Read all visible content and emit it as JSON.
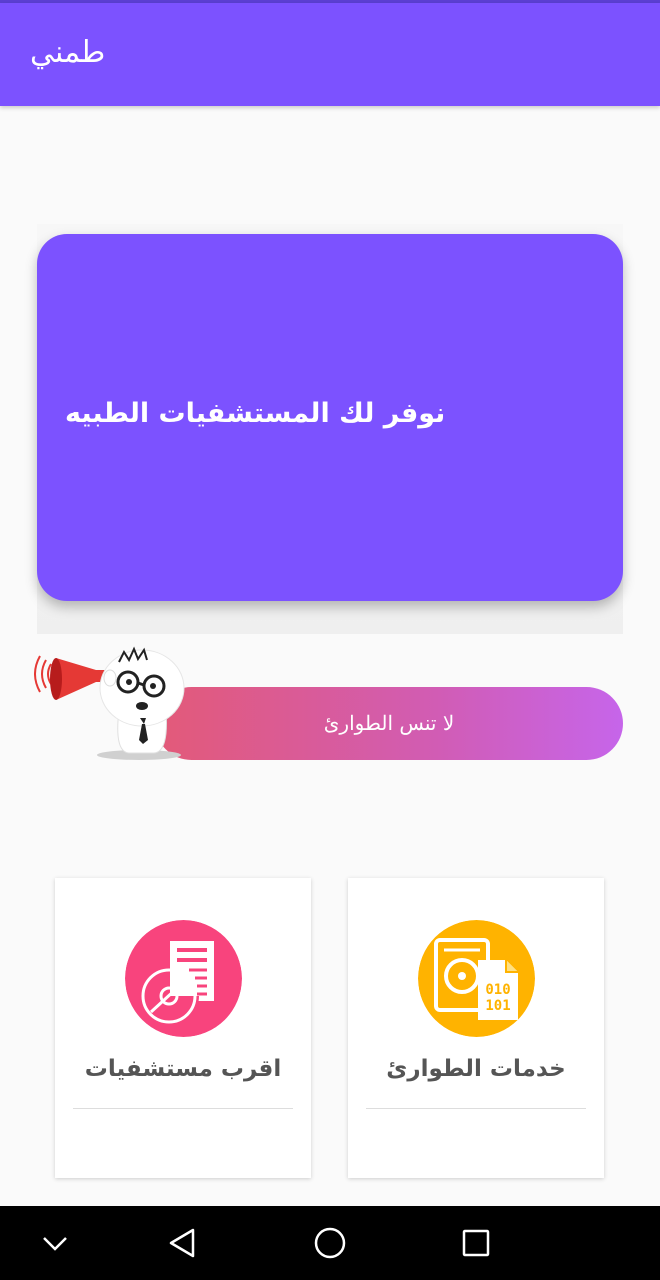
{
  "app_bar": {
    "title": "طمني"
  },
  "banner": {
    "text": "نوفر لك المستشفيات الطبيه"
  },
  "reminder": {
    "text": "لا تنس الطوارئ"
  },
  "cards": [
    {
      "label": "اقرب مستشفيات",
      "icon": "medical-document-disc-icon",
      "color": "#f8447d"
    },
    {
      "label": "خدمات الطوارئ",
      "icon": "hard-drive-binary-file-icon",
      "color": "#ffb300"
    }
  ],
  "colors": {
    "primary": "#7c52ff",
    "reminder_gradient": [
      "#e35a78",
      "#c665ea"
    ],
    "nav_bar": "#000000"
  },
  "navigation": [
    "chevron-down-icon",
    "back-triangle-icon",
    "home-circle-icon",
    "recents-square-icon"
  ]
}
